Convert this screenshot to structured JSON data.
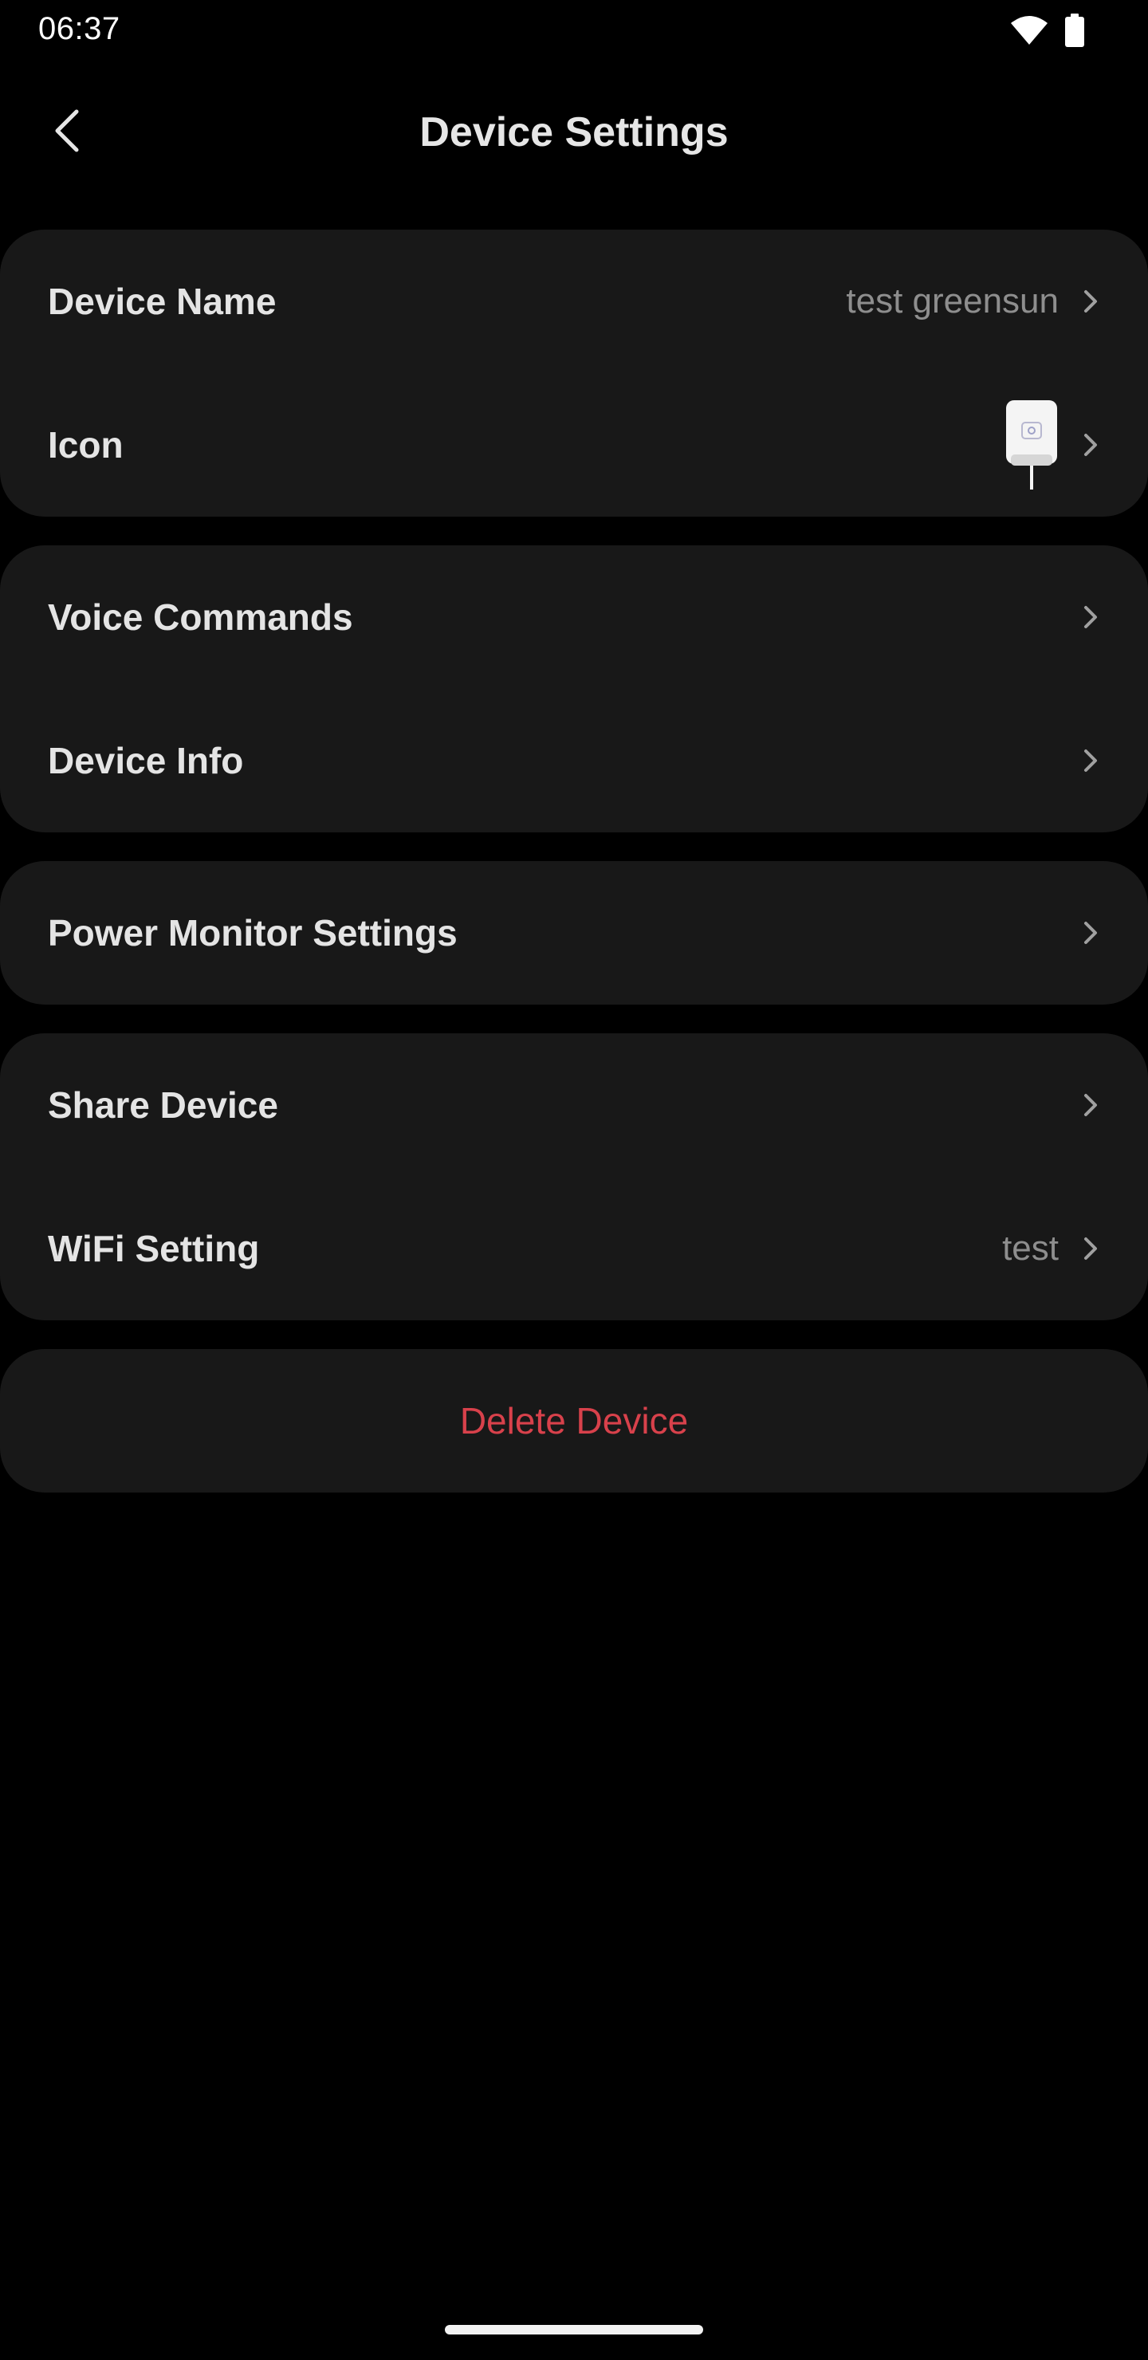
{
  "status_bar": {
    "time": "06:37",
    "icons": [
      "wifi-icon",
      "battery-icon"
    ]
  },
  "header": {
    "title": "Device Settings",
    "back_icon": "chevron-left-icon"
  },
  "sections": [
    {
      "rows": [
        {
          "label": "Device Name",
          "value": "test greensun"
        },
        {
          "label": "Icon",
          "value": ""
        }
      ]
    },
    {
      "rows": [
        {
          "label": "Voice Commands",
          "value": ""
        },
        {
          "label": "Device Info",
          "value": ""
        }
      ]
    },
    {
      "rows": [
        {
          "label": "Power Monitor Settings",
          "value": ""
        }
      ]
    },
    {
      "rows": [
        {
          "label": "Share Device",
          "value": ""
        },
        {
          "label": "WiFi Setting",
          "value": "test"
        }
      ]
    }
  ],
  "delete": {
    "label": "Delete Device"
  },
  "colors": {
    "background": "#000000",
    "card": "#181818",
    "primary_text": "#e4e4e4",
    "secondary_text": "#8e8e8e",
    "danger": "#d8414b"
  }
}
